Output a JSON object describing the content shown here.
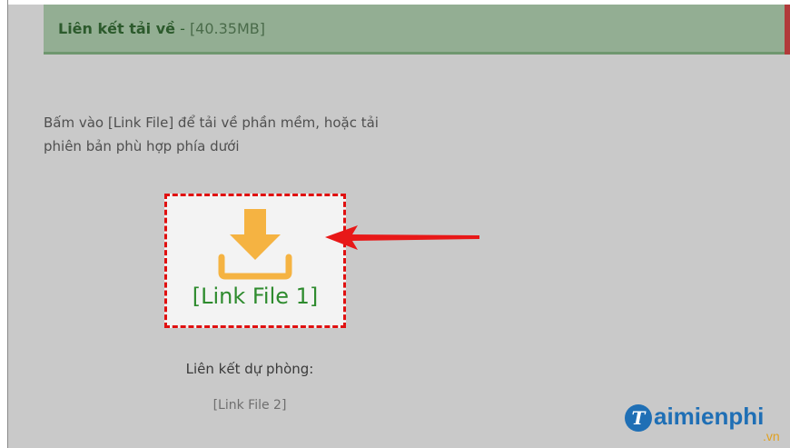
{
  "header": {
    "title": "Liên kết tải về",
    "separator": " - ",
    "size": "[40.35MB]"
  },
  "instructions": {
    "line1": "Bấm vào [Link File] để tải về phần mềm, hoặc tải",
    "line2": "phiên bản phù hợp phía dưới"
  },
  "download": {
    "icon": "download-icon",
    "link1_label": "[Link File 1]"
  },
  "backup": {
    "label": "Liên kết dự phòng:",
    "link2_label": "[Link File 2]"
  },
  "watermark": {
    "logo_letter": "T",
    "text": "aimienphi",
    "suffix": ".vn"
  },
  "colors": {
    "header_bg": "#93ae93",
    "link_green": "#2e8b2e",
    "highlight_red": "#e01010",
    "icon_orange": "#f5b342",
    "watermark_blue": "#1f6fb5"
  }
}
